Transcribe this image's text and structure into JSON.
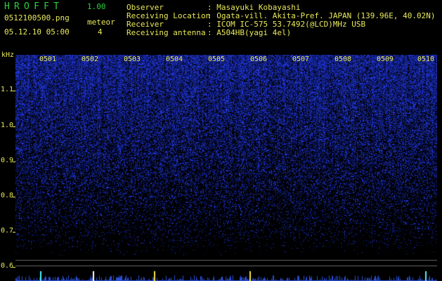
{
  "header": {
    "app_name": "HROFFT",
    "version": "1.00",
    "filename": "0512100500.png",
    "datetime": "05.12.10 05:00",
    "meteor_label": "meteor",
    "meteor_count": "4",
    "info_lines": [
      {
        "label": "Observer",
        "value": "Masayuki Kobayashi"
      },
      {
        "label": "Receiving Location",
        "value": "Ogata-vill. Akita-Pref. JAPAN (139.96E, 40.02N)"
      },
      {
        "label": "Receiver",
        "value": "ICOM IC-575 53.7492(@LCD)MHz USB"
      },
      {
        "label": "Receiving antenna",
        "value": "A504HB(yagi 4el)"
      }
    ]
  },
  "spectrogram": {
    "y_unit": "kHz",
    "y_ticks": [
      "1.1",
      "1.0",
      "0.9",
      "0.8",
      "0.7",
      "0.6"
    ],
    "x_labels": [
      "0501",
      "0502",
      "0503",
      "0504",
      "0505",
      "0506",
      "0507",
      "0508",
      "0509",
      "0510"
    ]
  },
  "colors": {
    "text_yellow": "#e9e95a",
    "title_green": "#2bd13d",
    "background": "#000000",
    "noise_blue": "#2a46d8",
    "burst_cyan": "#4ff0ff",
    "burst_yellow": "#f0e64a"
  }
}
